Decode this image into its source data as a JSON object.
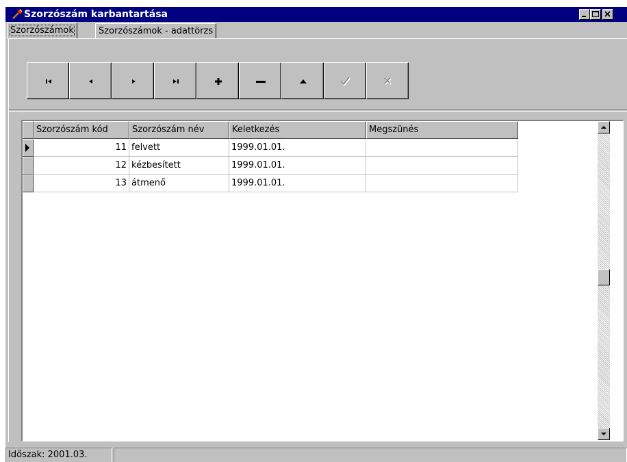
{
  "window": {
    "title": "Szorzószám karbantartása",
    "icon": "app-key-icon"
  },
  "tabs": [
    {
      "label": "Szorzószámok",
      "active": true
    },
    {
      "label": "Szorzószámok - adattörzs",
      "active": false
    }
  ],
  "navigator": [
    {
      "name": "first-record-button",
      "icon": "first-icon",
      "enabled": true
    },
    {
      "name": "prior-record-button",
      "icon": "prior-icon",
      "enabled": true
    },
    {
      "name": "next-record-button",
      "icon": "next-icon",
      "enabled": true
    },
    {
      "name": "last-record-button",
      "icon": "last-icon",
      "enabled": true
    },
    {
      "name": "insert-record-button",
      "icon": "plus-icon",
      "enabled": true
    },
    {
      "name": "delete-record-button",
      "icon": "minus-icon",
      "enabled": true
    },
    {
      "name": "edit-record-button",
      "icon": "up-triangle-icon",
      "enabled": true
    },
    {
      "name": "post-record-button",
      "icon": "check-icon",
      "enabled": false
    },
    {
      "name": "cancel-record-button",
      "icon": "x-icon",
      "enabled": false
    }
  ],
  "grid": {
    "columns": [
      "Szorzószám kód",
      "Szorzószám név",
      "Keletkezés",
      "Megszünés"
    ],
    "rows": [
      {
        "kod": "11",
        "nev": "felvett",
        "keletkezes": "1999.01.01.",
        "megszunes": ""
      },
      {
        "kod": "12",
        "nev": "kézbesített",
        "keletkezes": "1999.01.01.",
        "megszunes": ""
      },
      {
        "kod": "13",
        "nev": "átmenő",
        "keletkezes": "1999.01.01.",
        "megszunes": ""
      }
    ],
    "current_row": 0
  },
  "status": {
    "period": "Időszak: 2001.03.",
    "second_panel": ""
  },
  "colors": {
    "titlebar": "#000080",
    "face": "#c0c0c0"
  }
}
